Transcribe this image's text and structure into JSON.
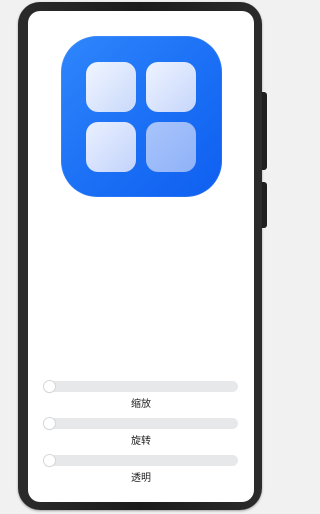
{
  "app_icon": {
    "name": "grid-app-icon",
    "accent": "#1a6ff5"
  },
  "sliders": [
    {
      "label": "缩放",
      "value": 0
    },
    {
      "label": "旋转",
      "value": 0
    },
    {
      "label": "透明",
      "value": 0
    }
  ],
  "colors": {
    "track": "#e7e8ea",
    "active": "#0a59f7",
    "screen": "#ffffff"
  }
}
